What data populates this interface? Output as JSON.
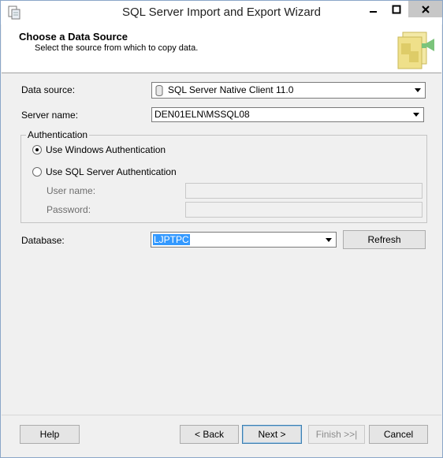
{
  "window": {
    "title": "SQL Server Import and Export Wizard"
  },
  "header": {
    "title": "Choose a Data Source",
    "subtitle": "Select the source from which to copy data."
  },
  "form": {
    "data_source_label": "Data source:",
    "data_source_value": "SQL Server Native Client 11.0",
    "server_name_label": "Server name:",
    "server_name_value": "DEN01ELN\\MSSQL08",
    "auth_group_label": "Authentication",
    "windows_auth_label": "Use Windows Authentication",
    "sql_auth_label": "Use SQL Server Authentication",
    "windows_auth_selected": true,
    "user_name_label": "User name:",
    "password_label": "Password:",
    "database_label": "Database:",
    "database_value": "LJPTPC",
    "refresh_label": "Refresh"
  },
  "footer": {
    "help_label": "Help",
    "back_label": "< Back",
    "next_label": "Next >",
    "finish_label": "Finish >>|",
    "cancel_label": "Cancel"
  },
  "icons": {
    "app": "wizard-app-icon",
    "datasource": "database-cylinder-icon",
    "header": "wizard-package-icon"
  }
}
